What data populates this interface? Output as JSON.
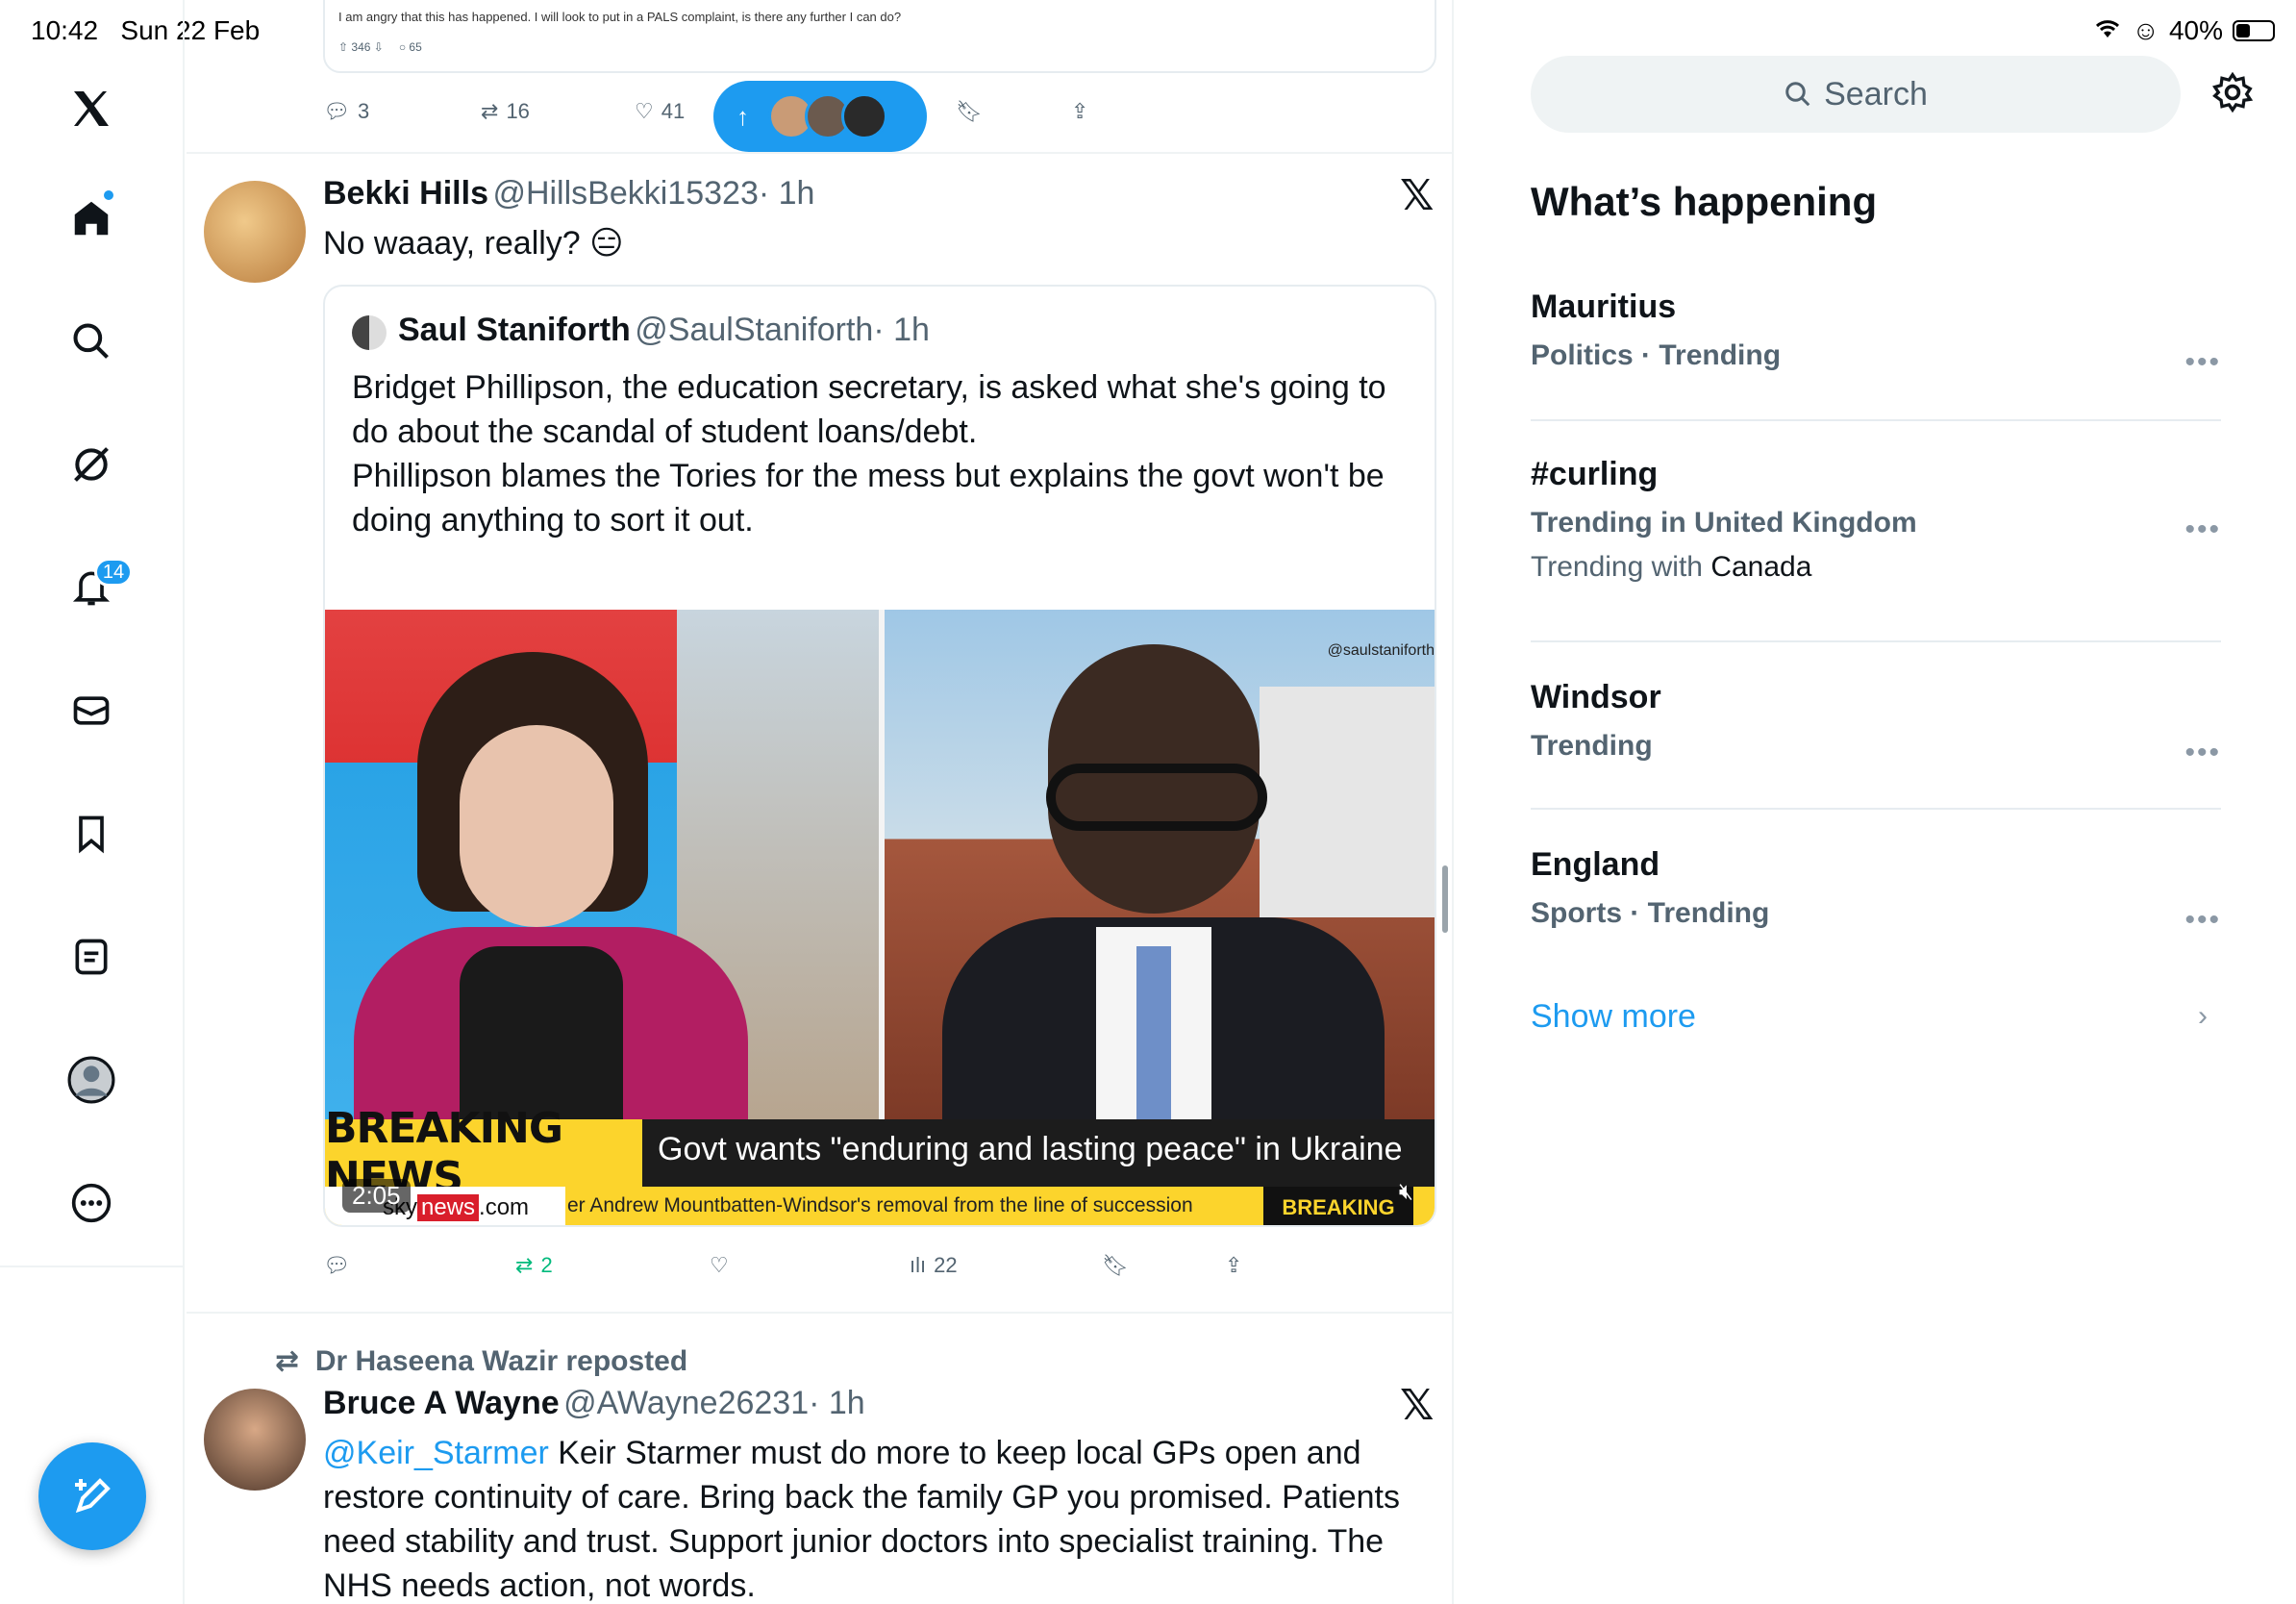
{
  "status": {
    "time": "10:42",
    "date": "Sun 22 Feb",
    "battery": "40%"
  },
  "nav": {
    "notifications_badge": "14",
    "items": [
      "x-logo-icon",
      "home-icon",
      "search-icon",
      "grok-icon",
      "notifications-icon",
      "messages-icon",
      "bookmarks-icon",
      "lists-icon",
      "profile-icon",
      "more-icon"
    ]
  },
  "top_card": {
    "text": "I am angry that this has happened. I will look to put in a PALS complaint, is there any further I can do?",
    "upvotes": "346",
    "replies": "65"
  },
  "prev_actions": {
    "replies": "3",
    "reposts": "16",
    "likes": "41"
  },
  "tweet1": {
    "name": "Bekki Hills",
    "handle": "@HillsBekki15323",
    "time": "· 1h",
    "text": "No waaay, really? 😑",
    "quote": {
      "name": "Saul Staniforth",
      "handle": "@SaulStaniforth",
      "time": "· 1h",
      "para1": "Bridget Phillipson, the education secretary, is asked what she's going to do about the scandal of student loans/debt.",
      "para2": "Phillipson blames the Tories for the mess but explains the govt won't be doing anything to sort it out.",
      "video": {
        "watermark": "@saulstaniforth",
        "breaking_label": "BREAKING NEWS",
        "headline": "Govt wants \"enduring and lasting peace\" in Ukraine",
        "site_prefix": "sky",
        "site_news": "news",
        "site_suffix": ".com",
        "ticker": "er Andrew Mountbatten-Windsor's removal from the line of succession",
        "ticker_tag": "BREAKING",
        "duration": "2:05"
      }
    },
    "actions": {
      "replies": "",
      "reposts": "2",
      "likes": "",
      "views": "22"
    }
  },
  "tweet2": {
    "repost_by": "Dr Haseena Wazir reposted",
    "name": "Bruce A Wayne",
    "handle": "@AWayne26231",
    "time": "· 1h",
    "mention": "@Keir_Starmer",
    "text": " Keir Starmer must do more to keep local GPs open and restore continuity of care. Bring back the family GP you promised. Patients need stability and trust. Support junior doctors into specialist training. The NHS needs action, not words."
  },
  "sidebar": {
    "search_placeholder": "Search",
    "heading": "What’s happening",
    "trends": [
      {
        "title": "Mauritius",
        "meta": "Politics · Trending"
      },
      {
        "title": "#curling",
        "meta": "Trending in United Kingdom",
        "sub_prefix": "Trending with ",
        "sub_value": "Canada"
      },
      {
        "title": "Windsor",
        "meta": "Trending"
      },
      {
        "title": "England",
        "meta": "Sports · Trending"
      }
    ],
    "show_more": "Show more"
  },
  "colors": {
    "accent": "#1d9bf0",
    "repost_green": "#00ba7c",
    "text": "#0f1419",
    "secondary": "#536471"
  }
}
